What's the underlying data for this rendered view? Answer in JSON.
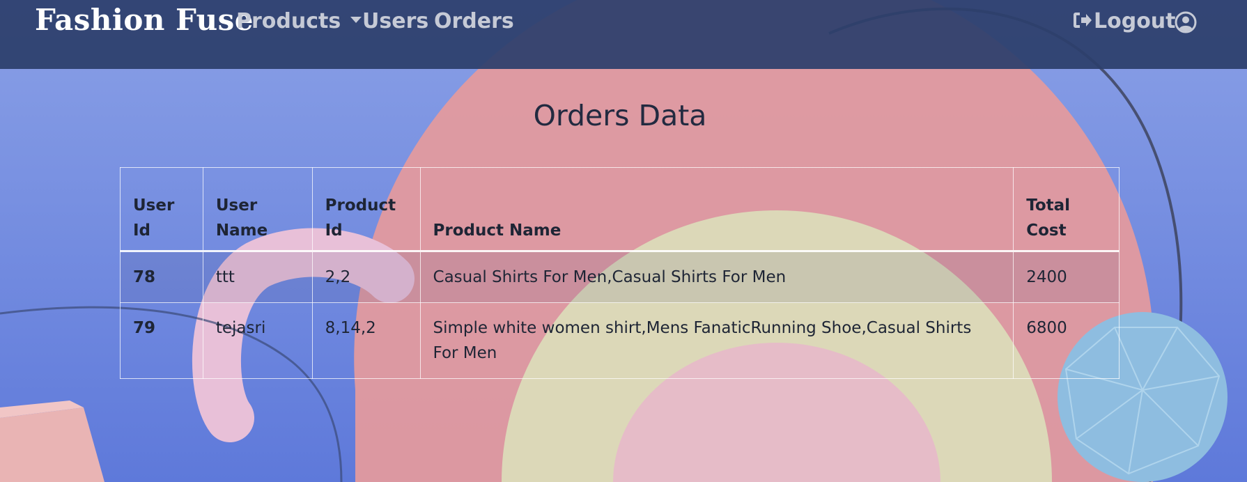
{
  "navbar": {
    "brand": "Fashion Fuse",
    "products_label": "Products",
    "users_label": "Users",
    "orders_label": "Orders",
    "logout_label": "Logout",
    "logout_icon": "sign-out-icon",
    "account_icon": "user-circle-icon"
  },
  "page": {
    "title": "Orders Data"
  },
  "table": {
    "headers": {
      "user_id": "User Id",
      "user_name": "User Name",
      "product_id": "Product Id",
      "product_name": "Product Name",
      "total_cost": "Total Cost"
    },
    "rows": [
      {
        "user_id": "78",
        "user_name": "ttt",
        "product_id": "2,2",
        "product_name": "Casual Shirts For Men,Casual Shirts For Men",
        "total_cost": "2400"
      },
      {
        "user_id": "79",
        "user_name": "tejasri",
        "product_id": "8,14,2",
        "product_name": "Simple white women shirt,Mens FanaticRunning Shoe,Casual Shirts For Men",
        "total_cost": "6800"
      }
    ]
  },
  "colors": {
    "navbar": "#2c3e6c",
    "background": "#6d86df",
    "arch_red": "#e39a9e",
    "arch_cream": "#dcd8b8",
    "arch_pink": "#e6bcc8"
  }
}
